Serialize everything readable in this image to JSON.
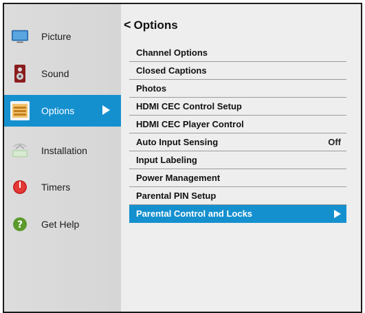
{
  "sidebar": {
    "items": [
      {
        "label": "Picture",
        "icon": "monitor-icon"
      },
      {
        "label": "Sound",
        "icon": "speaker-icon"
      },
      {
        "label": "Options",
        "icon": "options-panel-icon",
        "selected": true
      },
      {
        "label": "Installation",
        "icon": "antenna-icon"
      },
      {
        "label": "Timers",
        "icon": "timer-icon"
      },
      {
        "label": "Get Help",
        "icon": "help-icon"
      }
    ]
  },
  "header": {
    "back_glyph": "<",
    "title": "Options"
  },
  "menu": {
    "items": [
      {
        "label": "Channel Options",
        "value": ""
      },
      {
        "label": "Closed Captions",
        "value": ""
      },
      {
        "label": "Photos",
        "value": ""
      },
      {
        "label": "HDMI CEC Control Setup",
        "value": ""
      },
      {
        "label": "HDMI CEC Player Control",
        "value": ""
      },
      {
        "label": "Auto Input Sensing",
        "value": "Off"
      },
      {
        "label": "Input Labeling",
        "value": ""
      },
      {
        "label": "Power Management",
        "value": ""
      },
      {
        "label": "Parental PIN Setup",
        "value": ""
      },
      {
        "label": "Parental Control and Locks",
        "value": "",
        "selected": true
      }
    ]
  },
  "colors": {
    "accent": "#1590cf",
    "sidebar_bg": "#d9d9d9",
    "main_bg": "#eeeeee"
  }
}
